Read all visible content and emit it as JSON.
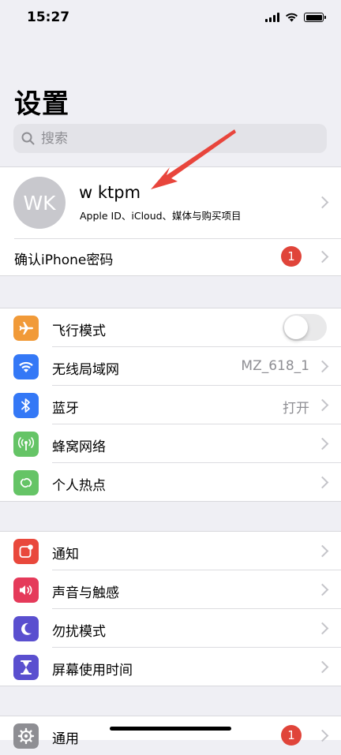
{
  "status_bar": {
    "time": "15:27"
  },
  "header": {
    "title": "设置"
  },
  "search": {
    "placeholder": "搜索"
  },
  "profile": {
    "initials": "WK",
    "name": "w ktpm",
    "subtitle": "Apple ID、iCloud、媒体与购买项目"
  },
  "confirm_password": {
    "label": "确认iPhone密码",
    "badge": "1"
  },
  "connectivity": {
    "airplane": {
      "label": "飞行模式",
      "on": false
    },
    "wifi": {
      "label": "无线局域网",
      "value": "MZ_618_1"
    },
    "bluetooth": {
      "label": "蓝牙",
      "value": "打开"
    },
    "cellular": {
      "label": "蜂窝网络"
    },
    "hotspot": {
      "label": "个人热点"
    }
  },
  "alerts": {
    "notifications": {
      "label": "通知"
    },
    "sounds": {
      "label": "声音与触感"
    },
    "dnd": {
      "label": "勿扰模式"
    },
    "screen_time": {
      "label": "屏幕使用时间"
    }
  },
  "general": {
    "label": "通用",
    "badge": "1"
  },
  "colors": {
    "airplane": "#f19a38",
    "wifi": "#3478f6",
    "bluetooth": "#3478f6",
    "cellular": "#65c466",
    "hotspot": "#65c466",
    "notifications": "#e9483c",
    "sounds": "#e53a5a",
    "dnd": "#5a4fcf",
    "screen_time": "#5a4fcf",
    "general": "#8e8e93",
    "badge": "#e0443a"
  },
  "icons": {
    "airplane": "airplane-icon",
    "wifi": "wifi-icon",
    "bluetooth": "bluetooth-icon",
    "cellular": "antenna-icon",
    "hotspot": "link-icon",
    "notifications": "notification-icon",
    "sounds": "speaker-icon",
    "dnd": "moon-icon",
    "screen_time": "hourglass-icon",
    "general": "gear-icon"
  }
}
